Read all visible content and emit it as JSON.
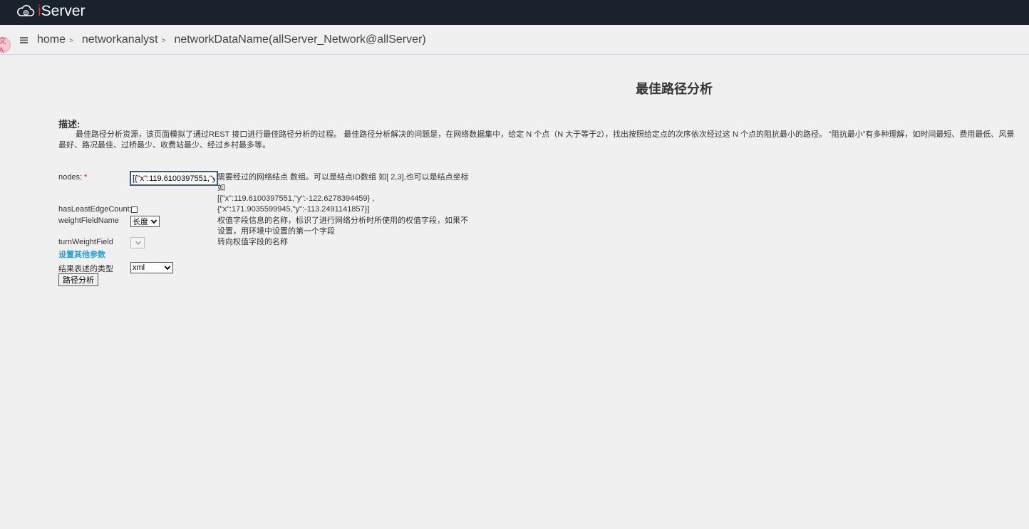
{
  "app": {
    "logo_prefix": "i",
    "logo_suffix": "Server"
  },
  "breadcrumb": {
    "items": [
      {
        "label": "home"
      },
      {
        "label": "networkanalyst"
      },
      {
        "label": "networkDataName(allServer_Network@allServer)"
      }
    ],
    "separator": ">"
  },
  "translate_badge": "文A",
  "page": {
    "title": "最佳路径分析",
    "description_label": "描述:",
    "description": "最佳路径分析资源，该页面模拟了通过REST 接口进行最佳路径分析的过程。 最佳路径分析解决的问题是，在网络数据集中，给定 N 个点（N 大于等于2），找出按照给定点的次序依次经过这 N 个点的阻抗最小的路径。 “阻抗最小”有多种理解，如时间最短、费用最低、风景最好、路况最佳、过桥最少、收费站最少、经过乡村最多等。"
  },
  "form": {
    "nodes": {
      "label": "nodes:",
      "required_mark": "*",
      "value": "[{\"x\":119.6100397551,\"y\":-122.6278394459},{\"x\":171.9035599945,\"y\":-113.2491141857}]",
      "hint_line1": "需要经过的网络结点 数组。可以是结点ID数组 如[ 2,3],也可以是结点坐标如",
      "hint_line2": "[{\"x\":119.6100397551,\"y\":-122.6278394459} ,",
      "hint_line3": "{\"x\":171.9035599945,\"y\":-113.2491141857}]"
    },
    "hasLeastEdgeCount": {
      "label": "hasLeastEdgeCount:",
      "checked": false
    },
    "weightFieldName": {
      "label": "weightFieldName",
      "selected": "长度",
      "hint": "权值字段信息的名称，标识了进行网络分析时所使用的权值字段，如果不设置，用环境中设置的第一个字段"
    },
    "turnWeightField": {
      "label": "turnWeightField",
      "selected": "",
      "hint": "转向权值字段的名称"
    },
    "other_params_link": "设置其他参数",
    "result_type": {
      "label": "结果表述的类型",
      "selected": "xml"
    },
    "submit_label": "路径分析"
  }
}
